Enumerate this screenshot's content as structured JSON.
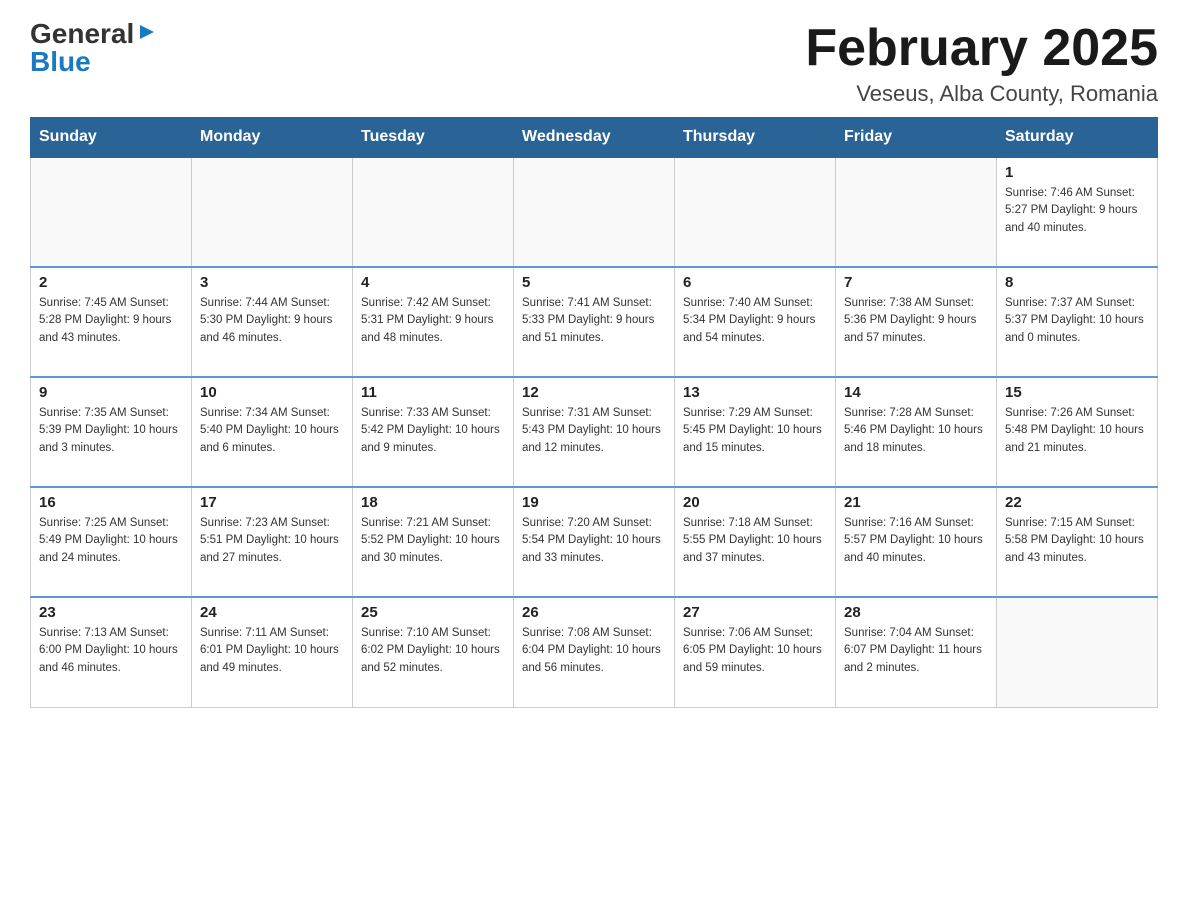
{
  "logo": {
    "general": "General",
    "blue": "Blue",
    "arrow": "▶"
  },
  "title": {
    "month_year": "February 2025",
    "location": "Veseus, Alba County, Romania"
  },
  "headers": [
    "Sunday",
    "Monday",
    "Tuesday",
    "Wednesday",
    "Thursday",
    "Friday",
    "Saturday"
  ],
  "weeks": [
    [
      {
        "day": "",
        "info": ""
      },
      {
        "day": "",
        "info": ""
      },
      {
        "day": "",
        "info": ""
      },
      {
        "day": "",
        "info": ""
      },
      {
        "day": "",
        "info": ""
      },
      {
        "day": "",
        "info": ""
      },
      {
        "day": "1",
        "info": "Sunrise: 7:46 AM\nSunset: 5:27 PM\nDaylight: 9 hours and 40 minutes."
      }
    ],
    [
      {
        "day": "2",
        "info": "Sunrise: 7:45 AM\nSunset: 5:28 PM\nDaylight: 9 hours and 43 minutes."
      },
      {
        "day": "3",
        "info": "Sunrise: 7:44 AM\nSunset: 5:30 PM\nDaylight: 9 hours and 46 minutes."
      },
      {
        "day": "4",
        "info": "Sunrise: 7:42 AM\nSunset: 5:31 PM\nDaylight: 9 hours and 48 minutes."
      },
      {
        "day": "5",
        "info": "Sunrise: 7:41 AM\nSunset: 5:33 PM\nDaylight: 9 hours and 51 minutes."
      },
      {
        "day": "6",
        "info": "Sunrise: 7:40 AM\nSunset: 5:34 PM\nDaylight: 9 hours and 54 minutes."
      },
      {
        "day": "7",
        "info": "Sunrise: 7:38 AM\nSunset: 5:36 PM\nDaylight: 9 hours and 57 minutes."
      },
      {
        "day": "8",
        "info": "Sunrise: 7:37 AM\nSunset: 5:37 PM\nDaylight: 10 hours and 0 minutes."
      }
    ],
    [
      {
        "day": "9",
        "info": "Sunrise: 7:35 AM\nSunset: 5:39 PM\nDaylight: 10 hours and 3 minutes."
      },
      {
        "day": "10",
        "info": "Sunrise: 7:34 AM\nSunset: 5:40 PM\nDaylight: 10 hours and 6 minutes."
      },
      {
        "day": "11",
        "info": "Sunrise: 7:33 AM\nSunset: 5:42 PM\nDaylight: 10 hours and 9 minutes."
      },
      {
        "day": "12",
        "info": "Sunrise: 7:31 AM\nSunset: 5:43 PM\nDaylight: 10 hours and 12 minutes."
      },
      {
        "day": "13",
        "info": "Sunrise: 7:29 AM\nSunset: 5:45 PM\nDaylight: 10 hours and 15 minutes."
      },
      {
        "day": "14",
        "info": "Sunrise: 7:28 AM\nSunset: 5:46 PM\nDaylight: 10 hours and 18 minutes."
      },
      {
        "day": "15",
        "info": "Sunrise: 7:26 AM\nSunset: 5:48 PM\nDaylight: 10 hours and 21 minutes."
      }
    ],
    [
      {
        "day": "16",
        "info": "Sunrise: 7:25 AM\nSunset: 5:49 PM\nDaylight: 10 hours and 24 minutes."
      },
      {
        "day": "17",
        "info": "Sunrise: 7:23 AM\nSunset: 5:51 PM\nDaylight: 10 hours and 27 minutes."
      },
      {
        "day": "18",
        "info": "Sunrise: 7:21 AM\nSunset: 5:52 PM\nDaylight: 10 hours and 30 minutes."
      },
      {
        "day": "19",
        "info": "Sunrise: 7:20 AM\nSunset: 5:54 PM\nDaylight: 10 hours and 33 minutes."
      },
      {
        "day": "20",
        "info": "Sunrise: 7:18 AM\nSunset: 5:55 PM\nDaylight: 10 hours and 37 minutes."
      },
      {
        "day": "21",
        "info": "Sunrise: 7:16 AM\nSunset: 5:57 PM\nDaylight: 10 hours and 40 minutes."
      },
      {
        "day": "22",
        "info": "Sunrise: 7:15 AM\nSunset: 5:58 PM\nDaylight: 10 hours and 43 minutes."
      }
    ],
    [
      {
        "day": "23",
        "info": "Sunrise: 7:13 AM\nSunset: 6:00 PM\nDaylight: 10 hours and 46 minutes."
      },
      {
        "day": "24",
        "info": "Sunrise: 7:11 AM\nSunset: 6:01 PM\nDaylight: 10 hours and 49 minutes."
      },
      {
        "day": "25",
        "info": "Sunrise: 7:10 AM\nSunset: 6:02 PM\nDaylight: 10 hours and 52 minutes."
      },
      {
        "day": "26",
        "info": "Sunrise: 7:08 AM\nSunset: 6:04 PM\nDaylight: 10 hours and 56 minutes."
      },
      {
        "day": "27",
        "info": "Sunrise: 7:06 AM\nSunset: 6:05 PM\nDaylight: 10 hours and 59 minutes."
      },
      {
        "day": "28",
        "info": "Sunrise: 7:04 AM\nSunset: 6:07 PM\nDaylight: 11 hours and 2 minutes."
      },
      {
        "day": "",
        "info": ""
      }
    ]
  ]
}
